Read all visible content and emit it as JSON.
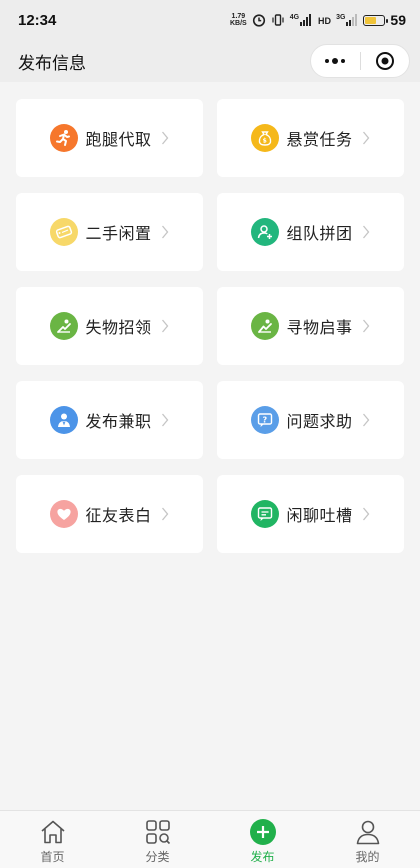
{
  "status_bar": {
    "time": "12:34",
    "net_speed_value": "1.79",
    "net_speed_unit": "KB/S",
    "signal_a": "4G",
    "signal_b": "3G",
    "battery": "59",
    "battery_level_percent": 59
  },
  "nav": {
    "title": "发布信息"
  },
  "cards": [
    {
      "label": "跑腿代取",
      "icon": "running-person-icon",
      "color": "#f6772c"
    },
    {
      "label": "悬赏任务",
      "icon": "money-bag-icon",
      "color": "#f5b81a"
    },
    {
      "label": "二手闲置",
      "icon": "price-tag-icon",
      "color": "#f7d869"
    },
    {
      "label": "组队拼团",
      "icon": "add-user-icon",
      "color": "#22b67d"
    },
    {
      "label": "失物招领",
      "icon": "lost-item-icon",
      "color": "#6ab544"
    },
    {
      "label": "寻物启事",
      "icon": "search-item-icon",
      "color": "#6ab544"
    },
    {
      "label": "发布兼职",
      "icon": "worker-icon",
      "color": "#4c94e8"
    },
    {
      "label": "问题求助",
      "icon": "question-chat-icon",
      "color": "#5a9ee8"
    },
    {
      "label": "征友表白",
      "icon": "heart-icon",
      "color": "#f6a3a0"
    },
    {
      "label": "闲聊吐槽",
      "icon": "chat-bubble-icon",
      "color": "#21b563"
    }
  ],
  "tabbar": {
    "items": [
      {
        "label": "首页",
        "icon": "home-icon"
      },
      {
        "label": "分类",
        "icon": "category-grid-icon"
      },
      {
        "label": "发布",
        "icon": "plus-circle-icon",
        "active": true
      },
      {
        "label": "我的",
        "icon": "user-icon"
      }
    ],
    "active_color": "#21b04b"
  }
}
